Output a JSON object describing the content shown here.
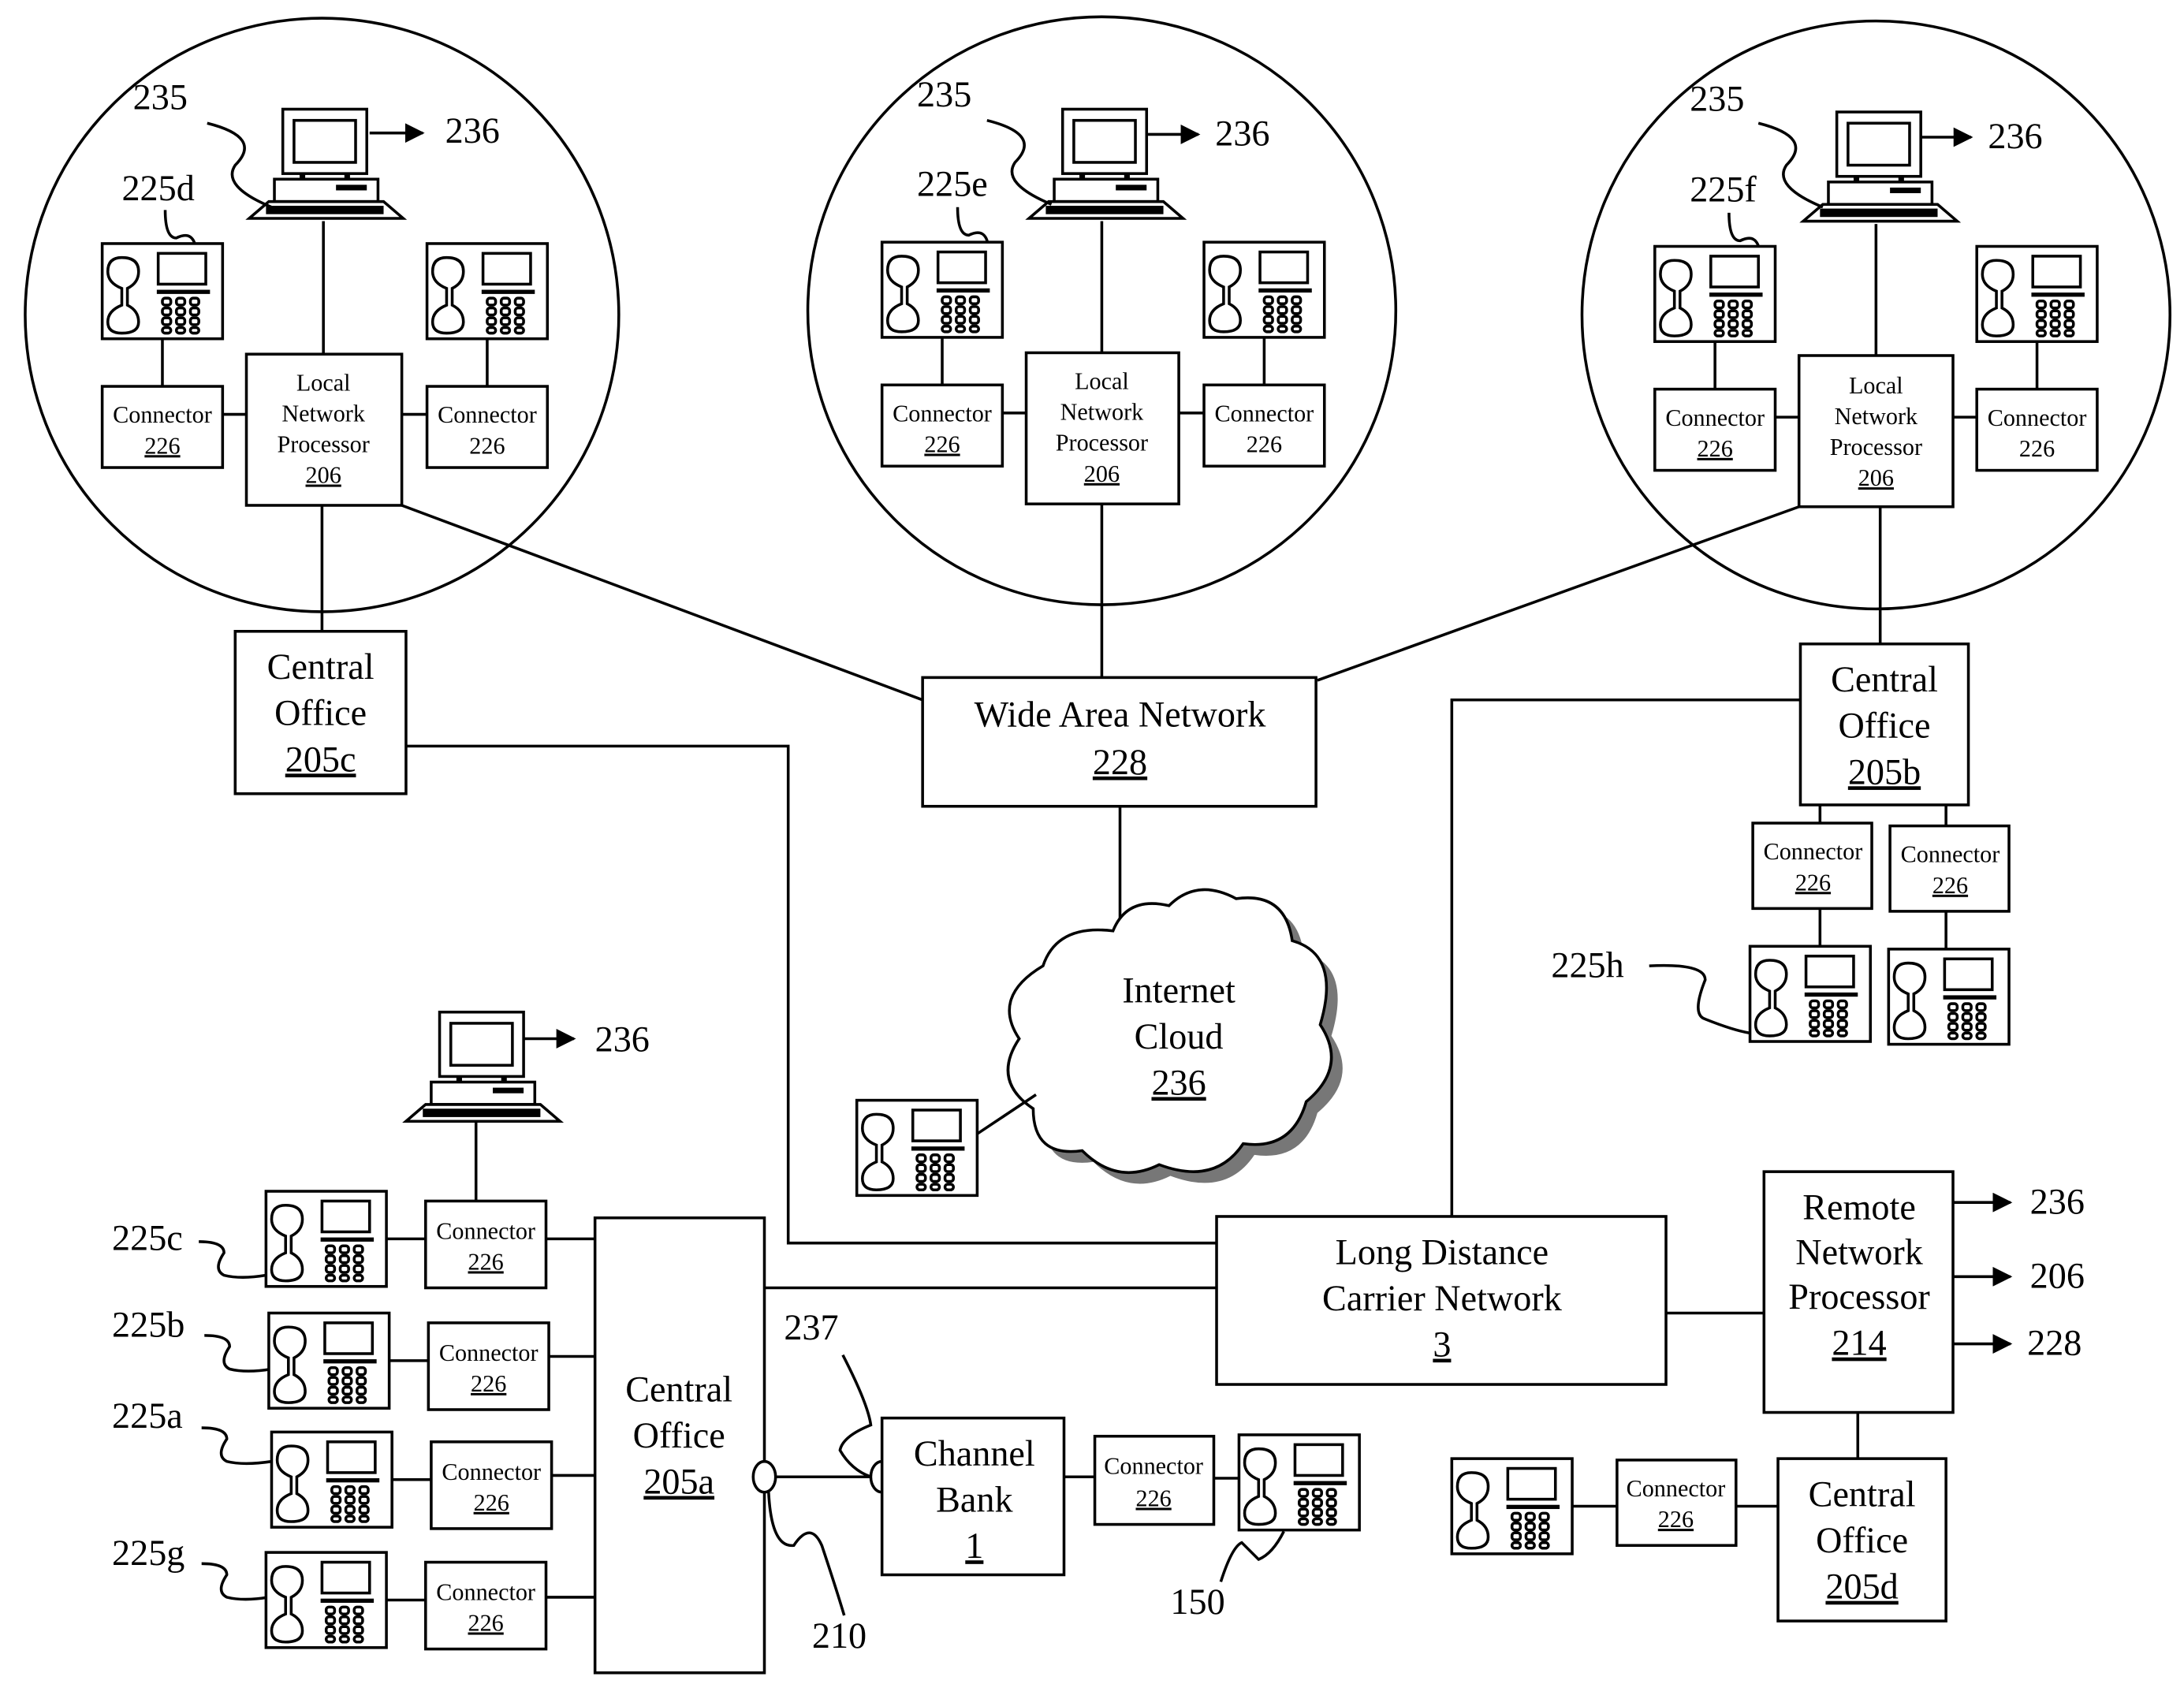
{
  "figure": {
    "local_sites": [
      {
        "computer_ref": "235",
        "computer_out": "236",
        "phone_ref": "225d",
        "lnp": [
          "Local",
          "Network",
          "Processor"
        ],
        "lnp_num": "206",
        "connector_label": "Connector",
        "connector_num": "226"
      },
      {
        "computer_ref": "235",
        "computer_out": "236",
        "phone_ref": "225e",
        "lnp": [
          "Local",
          "Network",
          "Processor"
        ],
        "lnp_num": "206",
        "connector_label": "Connector",
        "connector_num": "226"
      },
      {
        "computer_ref": "235",
        "computer_out": "236",
        "phone_ref": "225f",
        "lnp": [
          "Local",
          "Network",
          "Processor"
        ],
        "lnp_num": "206",
        "connector_label": "Connector",
        "connector_num": "226"
      }
    ],
    "central_office_c": {
      "line1": "Central",
      "line2": "Office",
      "num": "205c"
    },
    "central_office_b": {
      "line1": "Central",
      "line2": "Office",
      "num": "205b"
    },
    "central_office_a": {
      "line1": "Central",
      "line2": "Office",
      "num": "205a"
    },
    "central_office_d": {
      "line1": "Central",
      "line2": "Office",
      "num": "205d"
    },
    "wan": {
      "label": "Wide Area Network",
      "num": "228"
    },
    "cloud": {
      "line1": "Internet",
      "line2": "Cloud",
      "num": "236"
    },
    "ldcn": {
      "line1": "Long Distance",
      "line2": "Carrier Network",
      "num": "3"
    },
    "rnp": {
      "line1": "Remote",
      "line2": "Network",
      "line3": "Processor",
      "num": "214",
      "outputs": [
        "236",
        "206",
        "228"
      ]
    },
    "channel_bank": {
      "line1": "Channel",
      "line2": "Bank",
      "num": "1"
    },
    "connector": {
      "label": "Connector",
      "num": "226"
    },
    "refs": {
      "r236_bottom": "236",
      "r225c": "225c",
      "r225b": "225b",
      "r225a": "225a",
      "r225g": "225g",
      "r225h": "225h",
      "r237": "237",
      "r210": "210",
      "r150": "150"
    }
  }
}
